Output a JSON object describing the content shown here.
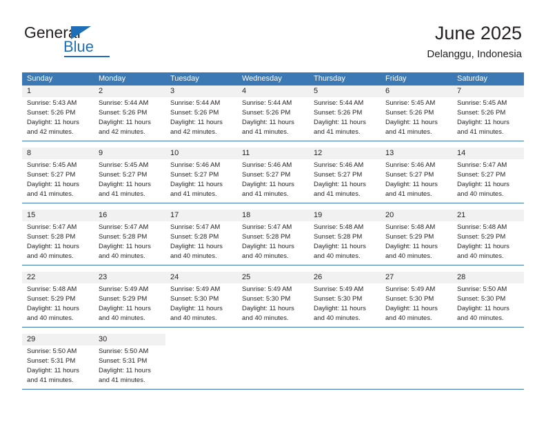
{
  "brand": {
    "word_one": "General",
    "word_two": "Blue"
  },
  "header": {
    "title": "June 2025",
    "subtitle": "Delanggu, Indonesia"
  },
  "theme": {
    "header_blue": "#3b78b4",
    "daynum_gray": "#f1f1f1",
    "text": "#231f20",
    "logo_blue": "#1f6fb8"
  },
  "weekdays": [
    "Sunday",
    "Monday",
    "Tuesday",
    "Wednesday",
    "Thursday",
    "Friday",
    "Saturday"
  ],
  "weeks": [
    {
      "days": [
        {
          "num": "1",
          "lines": [
            "Sunrise: 5:43 AM",
            "Sunset: 5:26 PM",
            "Daylight: 11 hours",
            "and 42 minutes."
          ]
        },
        {
          "num": "2",
          "lines": [
            "Sunrise: 5:44 AM",
            "Sunset: 5:26 PM",
            "Daylight: 11 hours",
            "and 42 minutes."
          ]
        },
        {
          "num": "3",
          "lines": [
            "Sunrise: 5:44 AM",
            "Sunset: 5:26 PM",
            "Daylight: 11 hours",
            "and 42 minutes."
          ]
        },
        {
          "num": "4",
          "lines": [
            "Sunrise: 5:44 AM",
            "Sunset: 5:26 PM",
            "Daylight: 11 hours",
            "and 41 minutes."
          ]
        },
        {
          "num": "5",
          "lines": [
            "Sunrise: 5:44 AM",
            "Sunset: 5:26 PM",
            "Daylight: 11 hours",
            "and 41 minutes."
          ]
        },
        {
          "num": "6",
          "lines": [
            "Sunrise: 5:45 AM",
            "Sunset: 5:26 PM",
            "Daylight: 11 hours",
            "and 41 minutes."
          ]
        },
        {
          "num": "7",
          "lines": [
            "Sunrise: 5:45 AM",
            "Sunset: 5:26 PM",
            "Daylight: 11 hours",
            "and 41 minutes."
          ]
        }
      ]
    },
    {
      "days": [
        {
          "num": "8",
          "lines": [
            "Sunrise: 5:45 AM",
            "Sunset: 5:27 PM",
            "Daylight: 11 hours",
            "and 41 minutes."
          ]
        },
        {
          "num": "9",
          "lines": [
            "Sunrise: 5:45 AM",
            "Sunset: 5:27 PM",
            "Daylight: 11 hours",
            "and 41 minutes."
          ]
        },
        {
          "num": "10",
          "lines": [
            "Sunrise: 5:46 AM",
            "Sunset: 5:27 PM",
            "Daylight: 11 hours",
            "and 41 minutes."
          ]
        },
        {
          "num": "11",
          "lines": [
            "Sunrise: 5:46 AM",
            "Sunset: 5:27 PM",
            "Daylight: 11 hours",
            "and 41 minutes."
          ]
        },
        {
          "num": "12",
          "lines": [
            "Sunrise: 5:46 AM",
            "Sunset: 5:27 PM",
            "Daylight: 11 hours",
            "and 41 minutes."
          ]
        },
        {
          "num": "13",
          "lines": [
            "Sunrise: 5:46 AM",
            "Sunset: 5:27 PM",
            "Daylight: 11 hours",
            "and 41 minutes."
          ]
        },
        {
          "num": "14",
          "lines": [
            "Sunrise: 5:47 AM",
            "Sunset: 5:27 PM",
            "Daylight: 11 hours",
            "and 40 minutes."
          ]
        }
      ]
    },
    {
      "days": [
        {
          "num": "15",
          "lines": [
            "Sunrise: 5:47 AM",
            "Sunset: 5:28 PM",
            "Daylight: 11 hours",
            "and 40 minutes."
          ]
        },
        {
          "num": "16",
          "lines": [
            "Sunrise: 5:47 AM",
            "Sunset: 5:28 PM",
            "Daylight: 11 hours",
            "and 40 minutes."
          ]
        },
        {
          "num": "17",
          "lines": [
            "Sunrise: 5:47 AM",
            "Sunset: 5:28 PM",
            "Daylight: 11 hours",
            "and 40 minutes."
          ]
        },
        {
          "num": "18",
          "lines": [
            "Sunrise: 5:47 AM",
            "Sunset: 5:28 PM",
            "Daylight: 11 hours",
            "and 40 minutes."
          ]
        },
        {
          "num": "19",
          "lines": [
            "Sunrise: 5:48 AM",
            "Sunset: 5:28 PM",
            "Daylight: 11 hours",
            "and 40 minutes."
          ]
        },
        {
          "num": "20",
          "lines": [
            "Sunrise: 5:48 AM",
            "Sunset: 5:29 PM",
            "Daylight: 11 hours",
            "and 40 minutes."
          ]
        },
        {
          "num": "21",
          "lines": [
            "Sunrise: 5:48 AM",
            "Sunset: 5:29 PM",
            "Daylight: 11 hours",
            "and 40 minutes."
          ]
        }
      ]
    },
    {
      "days": [
        {
          "num": "22",
          "lines": [
            "Sunrise: 5:48 AM",
            "Sunset: 5:29 PM",
            "Daylight: 11 hours",
            "and 40 minutes."
          ]
        },
        {
          "num": "23",
          "lines": [
            "Sunrise: 5:49 AM",
            "Sunset: 5:29 PM",
            "Daylight: 11 hours",
            "and 40 minutes."
          ]
        },
        {
          "num": "24",
          "lines": [
            "Sunrise: 5:49 AM",
            "Sunset: 5:30 PM",
            "Daylight: 11 hours",
            "and 40 minutes."
          ]
        },
        {
          "num": "25",
          "lines": [
            "Sunrise: 5:49 AM",
            "Sunset: 5:30 PM",
            "Daylight: 11 hours",
            "and 40 minutes."
          ]
        },
        {
          "num": "26",
          "lines": [
            "Sunrise: 5:49 AM",
            "Sunset: 5:30 PM",
            "Daylight: 11 hours",
            "and 40 minutes."
          ]
        },
        {
          "num": "27",
          "lines": [
            "Sunrise: 5:49 AM",
            "Sunset: 5:30 PM",
            "Daylight: 11 hours",
            "and 40 minutes."
          ]
        },
        {
          "num": "28",
          "lines": [
            "Sunrise: 5:50 AM",
            "Sunset: 5:30 PM",
            "Daylight: 11 hours",
            "and 40 minutes."
          ]
        }
      ]
    },
    {
      "days": [
        {
          "num": "29",
          "lines": [
            "Sunrise: 5:50 AM",
            "Sunset: 5:31 PM",
            "Daylight: 11 hours",
            "and 41 minutes."
          ]
        },
        {
          "num": "30",
          "lines": [
            "Sunrise: 5:50 AM",
            "Sunset: 5:31 PM",
            "Daylight: 11 hours",
            "and 41 minutes."
          ]
        },
        {
          "num": "",
          "lines": []
        },
        {
          "num": "",
          "lines": []
        },
        {
          "num": "",
          "lines": []
        },
        {
          "num": "",
          "lines": []
        },
        {
          "num": "",
          "lines": []
        }
      ]
    }
  ]
}
